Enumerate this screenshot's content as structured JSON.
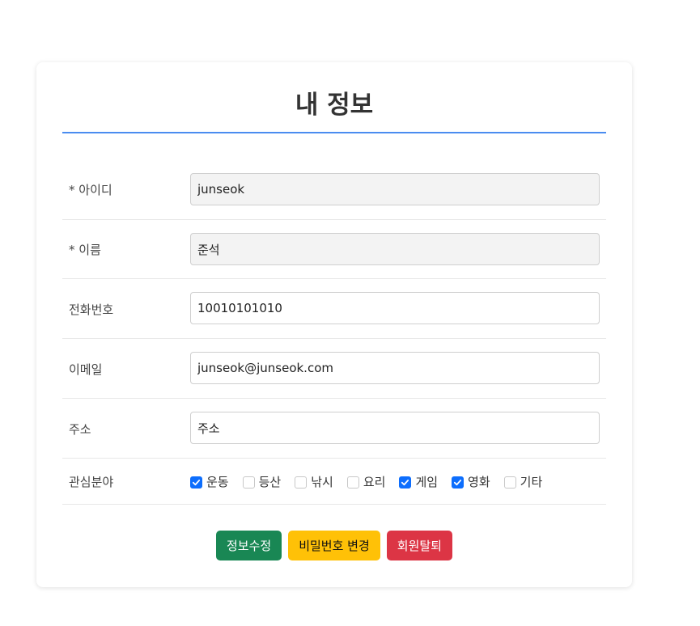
{
  "page": {
    "title": "내 정보"
  },
  "form": {
    "fields": [
      {
        "label": "* 아이디",
        "value": "junseok",
        "readonly": true
      },
      {
        "label": "* 이름",
        "value": "준석",
        "readonly": true
      },
      {
        "label": "전화번호",
        "value": "10010101010",
        "readonly": false
      },
      {
        "label": "이메일",
        "value": "junseok@junseok.com",
        "readonly": false
      },
      {
        "label": "주소",
        "value": "주소",
        "readonly": false
      }
    ],
    "interests": {
      "label": "관심분야",
      "options": [
        {
          "label": "운동",
          "checked": true
        },
        {
          "label": "등산",
          "checked": false
        },
        {
          "label": "낚시",
          "checked": false
        },
        {
          "label": "요리",
          "checked": false
        },
        {
          "label": "게임",
          "checked": true
        },
        {
          "label": "영화",
          "checked": true
        },
        {
          "label": "기타",
          "checked": false
        }
      ]
    }
  },
  "buttons": {
    "edit": "정보수정",
    "change_password": "비밀번호 변경",
    "withdraw": "회원탈퇴"
  },
  "colors": {
    "accent": "#4a8cf0",
    "checkbox": "#0d6efd",
    "edit_button": "#198754",
    "password_button": "#ffc107",
    "withdraw_button": "#dc3545"
  }
}
